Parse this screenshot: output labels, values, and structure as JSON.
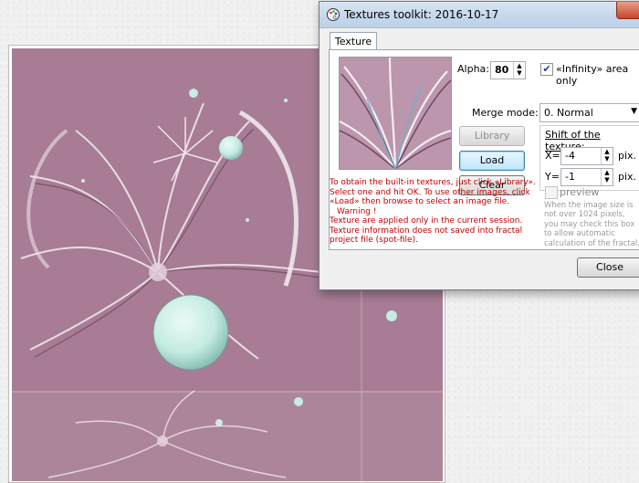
{
  "window": {
    "title": "Textures toolkit: 2016-10-17",
    "tab_label": "Texture"
  },
  "controls": {
    "alpha_label": "Alpha:",
    "alpha_value": "80",
    "merge_mode_label": "Merge mode:",
    "merge_mode_value": "0. Normal",
    "infinity_area_label": "«Infinity» area only",
    "infinity_area_checked": true,
    "library_button": "Library",
    "load_button": "Load",
    "clear_button": "Clear",
    "shift_title": "Shift of the texture:",
    "x_label": "X=",
    "x_value": "-4",
    "x_unit": "pix.",
    "y_label": "Y=",
    "y_value": "-1",
    "y_unit": "pix.",
    "preview_label": "preview",
    "preview_checked": false,
    "close_button": "Close"
  },
  "info": {
    "line1": "To obtain the built-in textures, just click «Library». Select one and hit OK. To use other images, click «Load» then browse to select an image file.",
    "warning": "Warning !",
    "line2": "Texture are applied only in the current session. Texture information does not saved into fractal project file (spot-file)."
  },
  "preview_hint": "When the image size is not over 1024 pixels, you may check this box to allow automatic calculation of the fractal.",
  "colors": {
    "fractal_base": "#a57a92",
    "orb": "#c7ece4",
    "info_text": "#c00000"
  },
  "icons": {
    "title_icon": "palette-icon",
    "spin_up": "arrow-up-icon",
    "spin_down": "arrow-down-icon",
    "dropdown": "chevron-down-icon"
  }
}
